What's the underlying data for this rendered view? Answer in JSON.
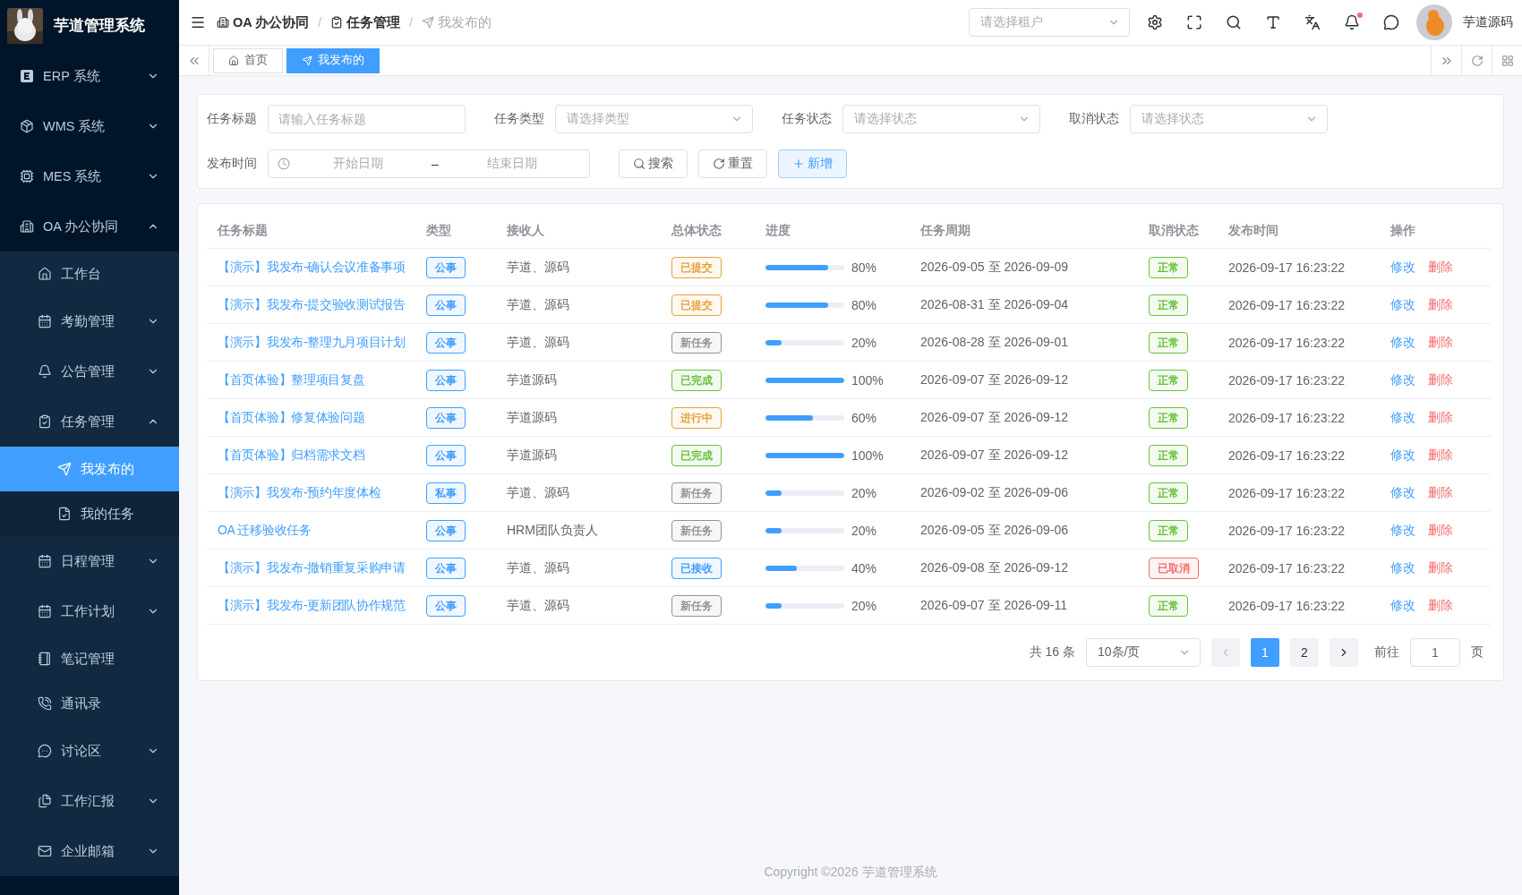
{
  "sidebar": {
    "title": "芋道管理系统",
    "items": [
      {
        "label": "ERP 系统",
        "kind": "group",
        "expanded": false,
        "selected": false
      },
      {
        "label": "WMS 系统",
        "kind": "group",
        "expanded": false,
        "selected": false
      },
      {
        "label": "MES 系统",
        "kind": "group",
        "expanded": false,
        "selected": false
      },
      {
        "label": "OA 办公协同",
        "kind": "group",
        "expanded": true,
        "selected": false,
        "children": [
          {
            "label": "工作台",
            "kind": "leaf",
            "selected": false
          },
          {
            "label": "考勤管理",
            "kind": "group",
            "expanded": false,
            "selected": false
          },
          {
            "label": "公告管理",
            "kind": "group",
            "expanded": false,
            "selected": false
          },
          {
            "label": "任务管理",
            "kind": "group",
            "expanded": true,
            "selected": false,
            "children": [
              {
                "label": "我发布的",
                "kind": "leaf",
                "selected": true
              },
              {
                "label": "我的任务",
                "kind": "leaf",
                "selected": false
              }
            ]
          },
          {
            "label": "日程管理",
            "kind": "group",
            "expanded": false,
            "selected": false
          },
          {
            "label": "工作计划",
            "kind": "group",
            "expanded": false,
            "selected": false
          },
          {
            "label": "笔记管理",
            "kind": "leaf",
            "selected": false
          },
          {
            "label": "通讯录",
            "kind": "leaf",
            "selected": false
          },
          {
            "label": "讨论区",
            "kind": "group",
            "expanded": false,
            "selected": false
          },
          {
            "label": "工作汇报",
            "kind": "group",
            "expanded": false,
            "selected": false
          },
          {
            "label": "企业邮箱",
            "kind": "group",
            "expanded": false,
            "selected": false
          }
        ]
      }
    ]
  },
  "header": {
    "breadcrumb_separator": "/",
    "breadcrumbs": [
      {
        "label": "OA 办公协同",
        "current": false
      },
      {
        "label": "任务管理",
        "current": false
      },
      {
        "label": "我发布的",
        "current": true
      }
    ],
    "tenant_select": {
      "placeholder": "请选择租户"
    },
    "notifications_unread": true,
    "user": "芋道源码"
  },
  "tabs": [
    {
      "label": "首页",
      "selected": false
    },
    {
      "label": "我发布的",
      "selected": true
    }
  ],
  "filters": {
    "fields": [
      {
        "label": "任务标题",
        "kind": "input",
        "placeholder": "请输入任务标题"
      },
      {
        "label": "任务类型",
        "kind": "select",
        "placeholder": "请选择类型"
      },
      {
        "label": "任务状态",
        "kind": "select",
        "placeholder": "请选择状态"
      },
      {
        "label": "取消状态",
        "kind": "select",
        "placeholder": "请选择状态"
      }
    ],
    "date_range": {
      "label": "发布时间",
      "start_placeholder": "开始日期",
      "separator": "–",
      "end_placeholder": "结束日期"
    },
    "buttons": [
      {
        "label": "搜索",
        "kind": "default"
      },
      {
        "label": "重置",
        "kind": "default"
      },
      {
        "label": "新增",
        "kind": "primary"
      }
    ]
  },
  "table": {
    "columns": [
      "任务标题",
      "类型",
      "接收人",
      "总体状态",
      "进度",
      "任务周期",
      "取消状态",
      "发布时间",
      "操作"
    ],
    "rows": [
      {
        "title": "【演示】我发布-确认会议准备事项",
        "type": "公事",
        "receiver": "芋道、源码",
        "status": {
          "text": "已提交",
          "color": "#e6a23c"
        },
        "progress": {
          "level": 0.8,
          "reading": "80%"
        },
        "period": "2026-09-05 至 2026-09-09",
        "cancel_status": {
          "text": "正常",
          "color": "#67c23a"
        },
        "published": "2026-09-17 16:23:22",
        "actions": [
          {
            "label": "修改",
            "kind": "edit"
          },
          {
            "label": "删除",
            "kind": "delete"
          }
        ]
      },
      {
        "title": "【演示】我发布-提交验收测试报告",
        "type": "公事",
        "receiver": "芋道、源码",
        "status": {
          "text": "已提交",
          "color": "#e6a23c"
        },
        "progress": {
          "level": 0.8,
          "reading": "80%"
        },
        "period": "2026-08-31 至 2026-09-04",
        "cancel_status": {
          "text": "正常",
          "color": "#67c23a"
        },
        "published": "2026-09-17 16:23:22",
        "actions": [
          {
            "label": "修改",
            "kind": "edit"
          },
          {
            "label": "删除",
            "kind": "delete"
          }
        ]
      },
      {
        "title": "【演示】我发布-整理九月项目计划",
        "type": "公事",
        "receiver": "芋道、源码",
        "status": {
          "text": "新任务",
          "color": "#909399"
        },
        "progress": {
          "level": 0.2,
          "reading": "20%"
        },
        "period": "2026-08-28 至 2026-09-01",
        "cancel_status": {
          "text": "正常",
          "color": "#67c23a"
        },
        "published": "2026-09-17 16:23:22",
        "actions": [
          {
            "label": "修改",
            "kind": "edit"
          },
          {
            "label": "删除",
            "kind": "delete"
          }
        ]
      },
      {
        "title": "【首页体验】整理项目复盘",
        "type": "公事",
        "receiver": "芋道源码",
        "status": {
          "text": "已完成",
          "color": "#67c23a"
        },
        "progress": {
          "level": 1,
          "reading": "100%"
        },
        "period": "2026-09-07 至 2026-09-12",
        "cancel_status": {
          "text": "正常",
          "color": "#67c23a"
        },
        "published": "2026-09-17 16:23:22",
        "actions": [
          {
            "label": "修改",
            "kind": "edit"
          },
          {
            "label": "删除",
            "kind": "delete"
          }
        ]
      },
      {
        "title": "【首页体验】修复体验问题",
        "type": "公事",
        "receiver": "芋道源码",
        "status": {
          "text": "进行中",
          "color": "#e6a23c"
        },
        "progress": {
          "level": 0.6,
          "reading": "60%"
        },
        "period": "2026-09-07 至 2026-09-12",
        "cancel_status": {
          "text": "正常",
          "color": "#67c23a"
        },
        "published": "2026-09-17 16:23:22",
        "actions": [
          {
            "label": "修改",
            "kind": "edit"
          },
          {
            "label": "删除",
            "kind": "delete"
          }
        ]
      },
      {
        "title": "【首页体验】归档需求文档",
        "type": "公事",
        "receiver": "芋道源码",
        "status": {
          "text": "已完成",
          "color": "#67c23a"
        },
        "progress": {
          "level": 1,
          "reading": "100%"
        },
        "period": "2026-09-07 至 2026-09-12",
        "cancel_status": {
          "text": "正常",
          "color": "#67c23a"
        },
        "published": "2026-09-17 16:23:22",
        "actions": [
          {
            "label": "修改",
            "kind": "edit"
          },
          {
            "label": "删除",
            "kind": "delete"
          }
        ]
      },
      {
        "title": "【演示】我发布-预约年度体检",
        "type": "私事",
        "receiver": "芋道、源码",
        "status": {
          "text": "新任务",
          "color": "#909399"
        },
        "progress": {
          "level": 0.2,
          "reading": "20%"
        },
        "period": "2026-09-02 至 2026-09-06",
        "cancel_status": {
          "text": "正常",
          "color": "#67c23a"
        },
        "published": "2026-09-17 16:23:22",
        "actions": [
          {
            "label": "修改",
            "kind": "edit"
          },
          {
            "label": "删除",
            "kind": "delete"
          }
        ]
      },
      {
        "title": "OA 迁移验收任务",
        "type": "公事",
        "receiver": "HRM团队负责人",
        "status": {
          "text": "新任务",
          "color": "#909399"
        },
        "progress": {
          "level": 0.2,
          "reading": "20%"
        },
        "period": "2026-09-05 至 2026-09-06",
        "cancel_status": {
          "text": "正常",
          "color": "#67c23a"
        },
        "published": "2026-09-17 16:23:22",
        "actions": [
          {
            "label": "修改",
            "kind": "edit"
          },
          {
            "label": "删除",
            "kind": "delete"
          }
        ]
      },
      {
        "title": "【演示】我发布-撤销重复采购申请",
        "type": "公事",
        "receiver": "芋道、源码",
        "status": {
          "text": "已接收",
          "color": "#409eff"
        },
        "progress": {
          "level": 0.4,
          "reading": "40%"
        },
        "period": "2026-09-08 至 2026-09-12",
        "cancel_status": {
          "text": "已取消",
          "color": "#f56c6c"
        },
        "published": "2026-09-17 16:23:22",
        "actions": [
          {
            "label": "修改",
            "kind": "edit"
          },
          {
            "label": "删除",
            "kind": "delete"
          }
        ]
      },
      {
        "title": "【演示】我发布-更新团队协作规范",
        "type": "公事",
        "receiver": "芋道、源码",
        "status": {
          "text": "新任务",
          "color": "#909399"
        },
        "progress": {
          "level": 0.2,
          "reading": "20%"
        },
        "period": "2026-09-07 至 2026-09-11",
        "cancel_status": {
          "text": "正常",
          "color": "#67c23a"
        },
        "published": "2026-09-17 16:23:22",
        "actions": [
          {
            "label": "修改",
            "kind": "edit"
          },
          {
            "label": "删除",
            "kind": "delete"
          }
        ]
      }
    ]
  },
  "pagination": {
    "total": "共 16 条",
    "page_size": "10条/页",
    "pages": [
      {
        "label": "1",
        "selected": true
      },
      {
        "label": "2",
        "selected": false
      }
    ],
    "goto_label": "前往",
    "goto_value": "1",
    "goto_suffix": "页"
  },
  "footer": "Copyright ©2026 芋道管理系统"
}
